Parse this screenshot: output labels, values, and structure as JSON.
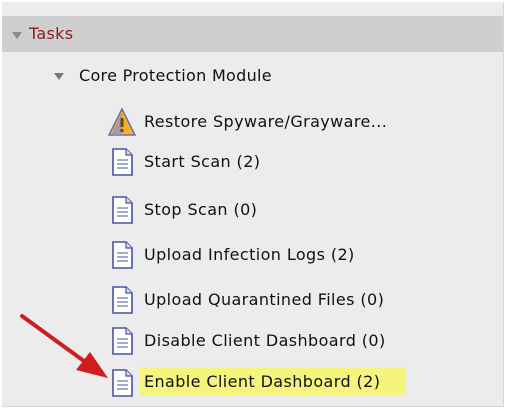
{
  "tasks_panel": {
    "title": "Tasks"
  },
  "module": {
    "label": "Core Protection Module"
  },
  "tasks": [
    {
      "label": "Restore Spyware/Grayware...",
      "icon": "warning-icon"
    },
    {
      "label": "Start Scan (2)",
      "icon": "document-icon"
    },
    {
      "label": "Stop Scan (0)",
      "icon": "document-icon"
    },
    {
      "label": "Upload Infection Logs (2)",
      "icon": "document-icon"
    },
    {
      "label": "Upload Quarantined Files (0)",
      "icon": "document-icon"
    },
    {
      "label": "Disable Client Dashboard (0)",
      "icon": "document-icon"
    },
    {
      "label": "Enable Client Dashboard (2)",
      "icon": "document-icon",
      "highlighted": true
    }
  ],
  "colors": {
    "header_bg": "#cfcfcf",
    "header_text": "#8c1d1d",
    "panel_bg": "#ececec",
    "highlight": "#f5f57e",
    "arrow": "#d01c1c"
  }
}
